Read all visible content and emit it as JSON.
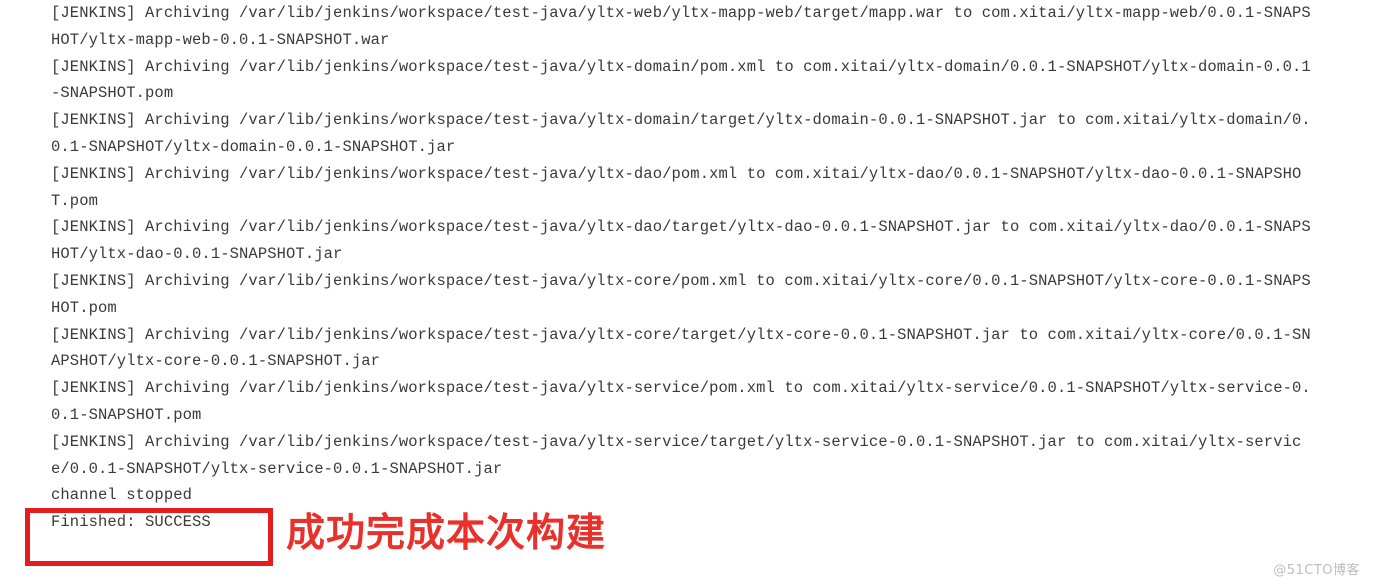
{
  "console": {
    "lines": [
      "[JENKINS] Archiving /var/lib/jenkins/workspace/test-java/yltx-web/yltx-mapp-web/target/mapp.war to com.xitai/yltx-mapp-web/0.0.1-SNAPSHOT/yltx-mapp-web-0.0.1-SNAPSHOT.war",
      "[JENKINS] Archiving /var/lib/jenkins/workspace/test-java/yltx-domain/pom.xml to com.xitai/yltx-domain/0.0.1-SNAPSHOT/yltx-domain-0.0.1-SNAPSHOT.pom",
      "[JENKINS] Archiving /var/lib/jenkins/workspace/test-java/yltx-domain/target/yltx-domain-0.0.1-SNAPSHOT.jar to com.xitai/yltx-domain/0.0.1-SNAPSHOT/yltx-domain-0.0.1-SNAPSHOT.jar",
      "[JENKINS] Archiving /var/lib/jenkins/workspace/test-java/yltx-dao/pom.xml to com.xitai/yltx-dao/0.0.1-SNAPSHOT/yltx-dao-0.0.1-SNAPSHOT.pom",
      "[JENKINS] Archiving /var/lib/jenkins/workspace/test-java/yltx-dao/target/yltx-dao-0.0.1-SNAPSHOT.jar to com.xitai/yltx-dao/0.0.1-SNAPSHOT/yltx-dao-0.0.1-SNAPSHOT.jar",
      "[JENKINS] Archiving /var/lib/jenkins/workspace/test-java/yltx-core/pom.xml to com.xitai/yltx-core/0.0.1-SNAPSHOT/yltx-core-0.0.1-SNAPSHOT.pom",
      "[JENKINS] Archiving /var/lib/jenkins/workspace/test-java/yltx-core/target/yltx-core-0.0.1-SNAPSHOT.jar to com.xitai/yltx-core/0.0.1-SNAPSHOT/yltx-core-0.0.1-SNAPSHOT.jar",
      "[JENKINS] Archiving /var/lib/jenkins/workspace/test-java/yltx-service/pom.xml to com.xitai/yltx-service/0.0.1-SNAPSHOT/yltx-service-0.0.1-SNAPSHOT.pom",
      "[JENKINS] Archiving /var/lib/jenkins/workspace/test-java/yltx-service/target/yltx-service-0.0.1-SNAPSHOT.jar to com.xitai/yltx-service/0.0.1-SNAPSHOT/yltx-service-0.0.1-SNAPSHOT.jar",
      "channel stopped",
      "Finished: SUCCESS"
    ]
  },
  "annotation": {
    "note_text": "成功完成本次构建",
    "highlight_target": "Finished: SUCCESS",
    "color": "#e8312a",
    "box_color": "#e21e1e"
  },
  "watermark": {
    "text": "@51CTO博客"
  }
}
